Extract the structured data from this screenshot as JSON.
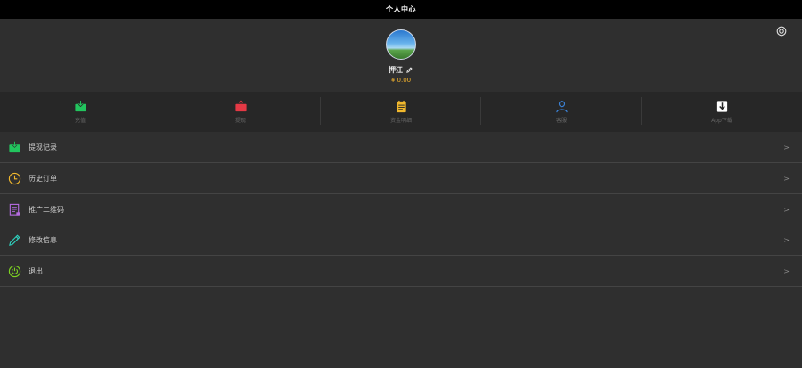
{
  "header": {
    "title": "个人中心"
  },
  "profile": {
    "name": "押江",
    "balance": "¥ 0.00"
  },
  "quick_actions": [
    {
      "label": "充值",
      "icon": "deposit-icon",
      "color": "#22c55e"
    },
    {
      "label": "提现",
      "icon": "withdraw-icon",
      "color": "#e53945"
    },
    {
      "label": "资金明细",
      "icon": "ledger-icon",
      "color": "#f1b82d"
    },
    {
      "label": "客服",
      "icon": "user-icon",
      "color": "#3b82d6"
    },
    {
      "label": "App下载",
      "icon": "download-icon",
      "color": "#ffffff"
    }
  ],
  "menu": [
    {
      "label": "提现记录",
      "icon": "withdraw-record-icon",
      "color": "#22c55e",
      "chevron": ">"
    },
    {
      "label": "历史订单",
      "icon": "clock-icon",
      "color": "#f1b82d",
      "chevron": ">"
    },
    {
      "label": "推广二维码",
      "icon": "qrcode-doc-icon",
      "color": "#b46be0",
      "chevron": ">"
    },
    {
      "label": "修改信息",
      "icon": "pencil-icon",
      "color": "#2fd3c0",
      "chevron": ">"
    },
    {
      "label": "退出",
      "icon": "power-icon",
      "color": "#7dd321",
      "chevron": ">"
    }
  ]
}
